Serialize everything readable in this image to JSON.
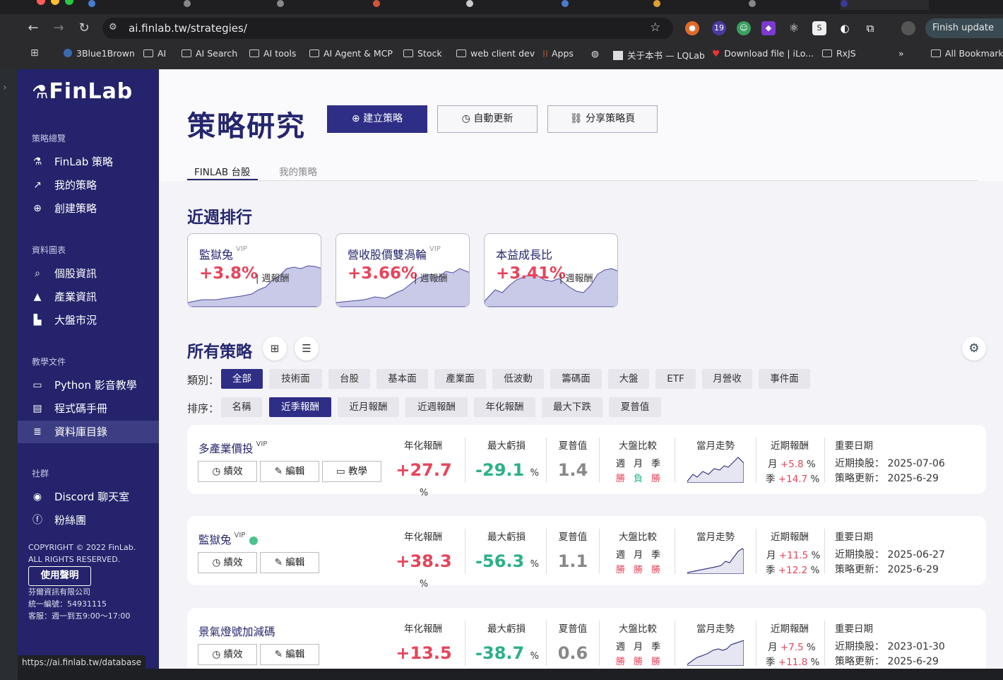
{
  "browser": {
    "url": "ai.finlab.tw/strategies/",
    "finish_update": "Finish update",
    "ext_badge": "19",
    "bookmarks": [
      "3Blue1Brown",
      "AI",
      "AI Search",
      "AI tools",
      "AI Agent & MCP",
      "Stock",
      "web client dev",
      "Apps",
      "关于本书 — LQLab",
      "Download file | iLo...",
      "RxJS",
      "All Bookmarks"
    ],
    "status_url": "https://ai.finlab.tw/database"
  },
  "sidebar": {
    "logo": "FinLab",
    "sections": [
      {
        "title": "策略總覽",
        "items": [
          "FinLab 策略",
          "我的策略",
          "創建策略"
        ]
      },
      {
        "title": "資料圖表",
        "items": [
          "個股資訊",
          "產業資訊",
          "大盤市況"
        ]
      },
      {
        "title": "教學文件",
        "items": [
          "Python 影音教學",
          "程式碼手冊",
          "資料庫目錄"
        ]
      },
      {
        "title": "社群",
        "items": [
          "Discord 聊天室",
          "粉絲團"
        ]
      }
    ],
    "copyright1": "COPYRIGHT © 2022 FinLab.",
    "copyright2": "ALL RIGHTS RESERVED.",
    "terms": "使用聲明",
    "company": "芬爾資訊有限公司",
    "tax_id": "統一編號：54931115",
    "service": "客服：週一到五9:00～17:00"
  },
  "header": {
    "title": "策略研究",
    "create": "建立策略",
    "auto_update": "自動更新",
    "share": "分享策略頁",
    "tabs": [
      "FINLAB 台股",
      "我的策略"
    ]
  },
  "weekly": {
    "title": "近週排行",
    "week_label": "週報酬",
    "items": [
      {
        "name": "監獄兔",
        "vip": "VIP",
        "pct": "+3.8%"
      },
      {
        "name": "營收股價雙渦輪",
        "vip": "VIP",
        "pct": "+3.66%"
      },
      {
        "name": "本益成長比",
        "vip": "",
        "pct": "+3.41%"
      }
    ]
  },
  "all": {
    "title": "所有策略",
    "cat_label": "類別：",
    "sort_label": "排序：",
    "categories": [
      "全部",
      "技術面",
      "台股",
      "基本面",
      "產業面",
      "低波動",
      "籌碼面",
      "大盤",
      "ETF",
      "月營收",
      "事件面"
    ],
    "sorts": [
      "名稱",
      "近季報酬",
      "近月報酬",
      "近週報酬",
      "年化報酬",
      "最大下跌",
      "夏普值"
    ]
  },
  "cols": {
    "annual": "年化報酬",
    "mdd": "最大虧損",
    "sharpe": "夏普值",
    "bench": "大盤比較",
    "trend": "當月走勢",
    "recent": "近期報酬",
    "dates": "重要日期",
    "w": "週",
    "m": "月",
    "q": "季",
    "rebalance": "近期換股：",
    "updated": "策略更新：",
    "pct": "%",
    "btn_perf": "績效",
    "btn_edit": "編輯",
    "btn_teach": "教學"
  },
  "strategies": [
    {
      "name": "多產業價投",
      "vip": "VIP",
      "annual": "+27.7",
      "mdd": "-29.1",
      "sharpe": "1.4",
      "bw": "勝",
      "bm": "負",
      "bq": "勝",
      "rm": "+5.8",
      "rq": "+14.7",
      "rebalance": "2025-07-06",
      "updated": "2025-6-29"
    },
    {
      "name": "監獄兔",
      "vip": "VIP",
      "annual": "+38.3",
      "mdd": "-56.3",
      "sharpe": "1.1",
      "bw": "勝",
      "bm": "勝",
      "bq": "勝",
      "rm": "+11.5",
      "rq": "+12.2",
      "rebalance": "2025-06-27",
      "updated": "2025-6-29"
    },
    {
      "name": "景氣燈號加減碼",
      "vip": "",
      "annual": "+13.5",
      "mdd": "-38.7",
      "sharpe": "0.6",
      "bw": "勝",
      "bm": "勝",
      "bq": "勝",
      "rm": "+7.5",
      "rq": "+11.8",
      "rebalance": "2023-01-30",
      "updated": "2025-6-29"
    }
  ]
}
